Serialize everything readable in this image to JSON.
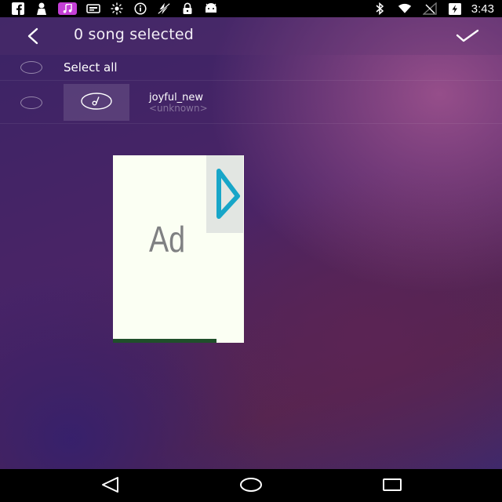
{
  "status_bar": {
    "left_icons": [
      "facebook-icon",
      "notification-icon",
      "music-icon",
      "media-icon",
      "brightness-icon",
      "info-icon",
      "no-fast-charge-icon",
      "lock-icon",
      "android-icon"
    ],
    "right_icons": [
      "bluetooth-icon",
      "wifi-icon",
      "no-signal-icon",
      "battery-charging-icon"
    ],
    "time": "3:43",
    "music_badge_color": "#c43fd6"
  },
  "header": {
    "back_icon": "back-arrow-icon",
    "title": "0 song selected",
    "confirm_icon": "checkmark-icon"
  },
  "list": {
    "select_all_label": "Select all",
    "songs": [
      {
        "title": "joyful_new",
        "artist": "<unknown>",
        "thumbnail_icon": "music-note-icon",
        "selected": false
      }
    ]
  },
  "ad": {
    "label": "Ad",
    "icon": "play-icon",
    "accent_color": "#17a6c8"
  },
  "nav_bar": {
    "icons": [
      "nav-back-icon",
      "nav-home-icon",
      "nav-recents-icon"
    ]
  }
}
